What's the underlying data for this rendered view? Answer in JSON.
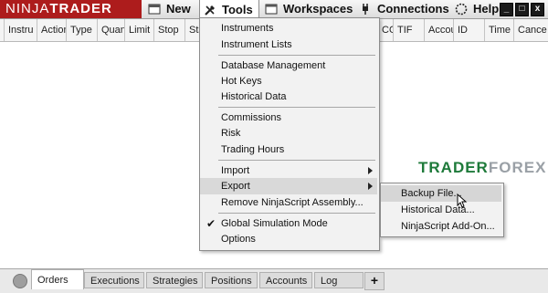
{
  "logo": {
    "part1": "NINJA",
    "part2": "TRADER"
  },
  "menu": {
    "new": "New",
    "tools": "Tools",
    "workspaces": "Workspaces",
    "connections": "Connections",
    "help": "Help"
  },
  "window_buttons": {
    "minimize": "_",
    "maximize": "□",
    "close": "x"
  },
  "columns": {
    "instrument": "Instru",
    "action": "Action",
    "type": "Type",
    "quantity": "Quan",
    "limit": "Limit",
    "stop": "Stop",
    "state": "Sta",
    "oco": "CO",
    "tif": "TIF",
    "account": "Accou",
    "id": "ID",
    "time": "Time",
    "cancel": "Cance"
  },
  "tools_menu": {
    "instruments": "Instruments",
    "instrument_lists": "Instrument Lists",
    "database_management": "Database Management",
    "hot_keys": "Hot Keys",
    "historical_data": "Historical Data",
    "commissions": "Commissions",
    "risk": "Risk",
    "trading_hours": "Trading Hours",
    "import": "Import",
    "export": "Export",
    "remove_ninjascript": "Remove NinjaScript Assembly...",
    "global_simulation_mode": "Global Simulation Mode",
    "options": "Options"
  },
  "export_submenu": {
    "backup_file": "Backup File...",
    "historical_data": "Historical Data...",
    "ninjascript_addon": "NinjaScript Add-On..."
  },
  "watermark": {
    "part1": "TRADER",
    "part2": "FOREX"
  },
  "tabs": {
    "orders": "Orders",
    "executions": "Executions",
    "strategies": "Strategies",
    "positions": "Positions",
    "accounts": "Accounts",
    "log": "Log",
    "add": "+"
  },
  "colors": {
    "logo_bg": "#ad1c1c",
    "watermark_green": "#1e7a3a",
    "watermark_grey": "#9aa0a6"
  }
}
